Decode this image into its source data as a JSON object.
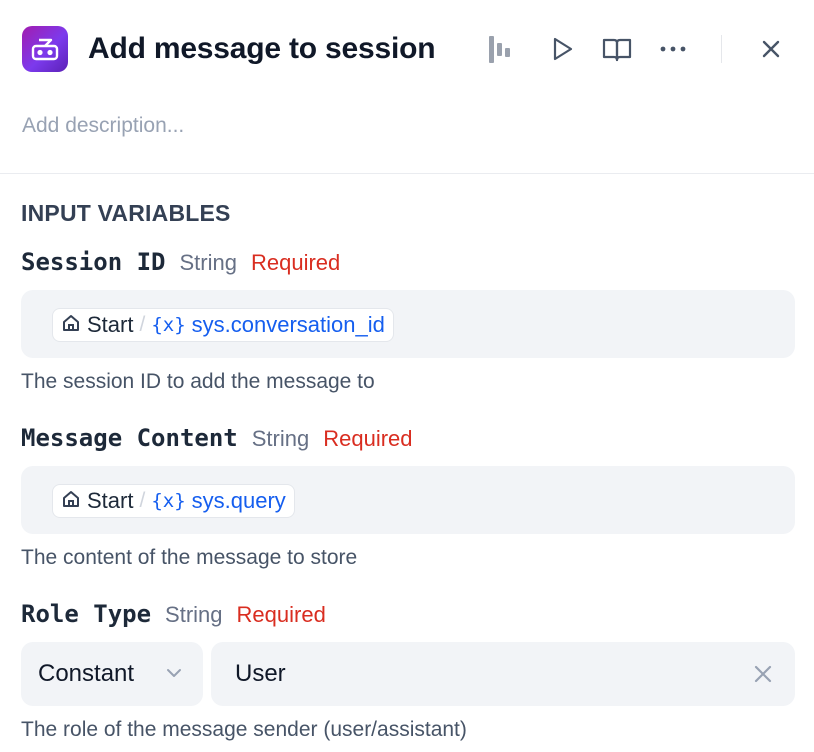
{
  "header": {
    "title": "Add message to session",
    "description_placeholder": "Add description...",
    "icons": {
      "app": "robot-icon",
      "stats": "bar-stats-icon",
      "run": "play-icon",
      "docs": "book-open-icon",
      "more": "more-horizontal-icon",
      "close": "close-icon"
    }
  },
  "section": {
    "title": "INPUT VARIABLES"
  },
  "variables": [
    {
      "name": "Session ID",
      "type": "String",
      "required": "Required",
      "node": "Start",
      "separator": "/",
      "var_icon": "{x}",
      "var": "sys.conversation_id",
      "description": "The session ID to add the message to"
    },
    {
      "name": "Message Content",
      "type": "String",
      "required": "Required",
      "node": "Start",
      "separator": "/",
      "var_icon": "{x}",
      "var": "sys.query",
      "description": "The content of the message to store"
    },
    {
      "name": "Role Type",
      "type": "String",
      "required": "Required",
      "mode": "Constant",
      "value": "User",
      "description": "The role of the message sender (user/assistant)"
    }
  ],
  "colors": {
    "required": "#d92d20",
    "variable": "#155eef",
    "field_bg": "#f2f4f7",
    "app_icon_gradient": [
      "#a21caf",
      "#5b21b6"
    ]
  }
}
